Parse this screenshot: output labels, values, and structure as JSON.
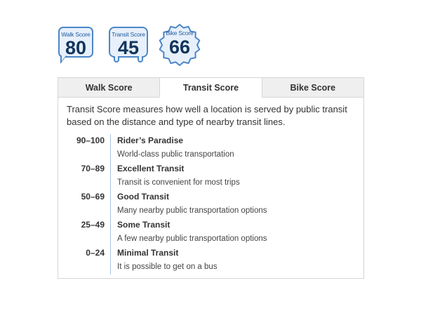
{
  "badges": {
    "walk": {
      "label": "Walk Score",
      "value": "80"
    },
    "transit": {
      "label": "Transit Score",
      "value": "45"
    },
    "bike": {
      "label": "Bike Score",
      "value": "66"
    }
  },
  "tabs": [
    {
      "label": "Walk Score",
      "active": false
    },
    {
      "label": "Transit Score",
      "active": true
    },
    {
      "label": "Bike Score",
      "active": false
    }
  ],
  "description": "Transit Score measures how well a location is served by public transit based on the distance and type of nearby transit lines.",
  "ranges": [
    {
      "range": "90–100",
      "title": "Rider’s Paradise",
      "desc": "World-class public transportation"
    },
    {
      "range": "70–89",
      "title": "Excellent Transit",
      "desc": "Transit is convenient for most trips"
    },
    {
      "range": "50–69",
      "title": "Good Transit",
      "desc": "Many nearby public transportation options"
    },
    {
      "range": "25–49",
      "title": "Some Transit",
      "desc": "A few nearby public transportation options"
    },
    {
      "range": "0–24",
      "title": "Minimal Transit",
      "desc": "It is possible to get on a bus"
    }
  ],
  "colors": {
    "badge_border": "#4d86c8",
    "badge_fill": "#e7f0fb",
    "badge_number": "#12355b",
    "tab_inactive": "#efefef",
    "divider": "#a9c4e3"
  }
}
